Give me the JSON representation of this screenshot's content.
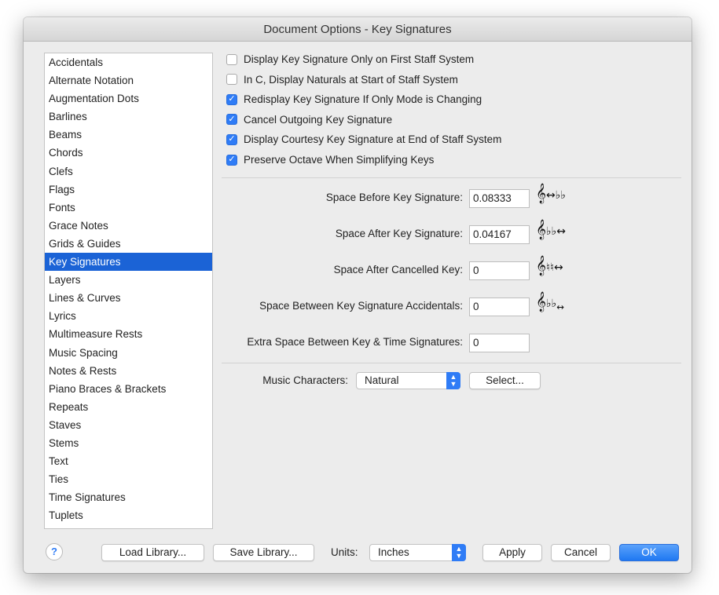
{
  "title": "Document Options - Key Signatures",
  "sidebar": {
    "items": [
      "Accidentals",
      "Alternate Notation",
      "Augmentation Dots",
      "Barlines",
      "Beams",
      "Chords",
      "Clefs",
      "Flags",
      "Fonts",
      "Grace Notes",
      "Grids & Guides",
      "Key Signatures",
      "Layers",
      "Lines & Curves",
      "Lyrics",
      "Multimeasure Rests",
      "Music Spacing",
      "Notes & Rests",
      "Piano Braces & Brackets",
      "Repeats",
      "Staves",
      "Stems",
      "Text",
      "Ties",
      "Time Signatures",
      "Tuplets"
    ],
    "selected": "Key Signatures"
  },
  "checkboxes": [
    {
      "label": "Display Key Signature Only on First Staff System",
      "checked": false
    },
    {
      "label": "In C, Display Naturals at Start of Staff System",
      "checked": false
    },
    {
      "label": "Redisplay Key Signature If Only Mode is Changing",
      "checked": true
    },
    {
      "label": "Cancel Outgoing Key Signature",
      "checked": true
    },
    {
      "label": "Display Courtesy Key Signature at End of Staff System",
      "checked": true
    },
    {
      "label": "Preserve Octave When Simplifying Keys",
      "checked": true
    }
  ],
  "fields": [
    {
      "label": "Space Before Key Signature:",
      "value": "0.08333",
      "icon": "treble-clef-space-flats-icon"
    },
    {
      "label": "Space After Key Signature:",
      "value": "0.04167",
      "icon": "treble-clef-flats-space-icon"
    },
    {
      "label": "Space After Cancelled Key:",
      "value": "0",
      "icon": "treble-clef-naturals-space-icon"
    },
    {
      "label": "Space Between Key Signature Accidentals:",
      "value": "0",
      "icon": "treble-clef-flats-between-icon"
    },
    {
      "label": "Extra Space Between Key & Time Signatures:",
      "value": "0"
    }
  ],
  "music_characters": {
    "label": "Music Characters:",
    "value": "Natural",
    "select_button": "Select..."
  },
  "footer": {
    "help": "?",
    "load": "Load Library...",
    "save": "Save Library...",
    "units_label": "Units:",
    "units": "Inches",
    "apply": "Apply",
    "cancel": "Cancel",
    "ok": "OK"
  },
  "colors": {
    "accent": "#2f7cf6",
    "selection": "#1b63d6"
  }
}
